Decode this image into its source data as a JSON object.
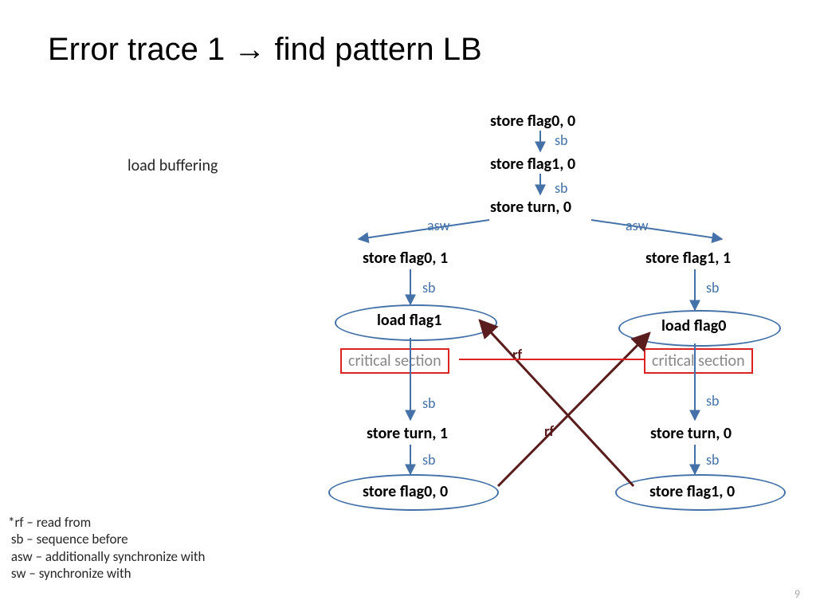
{
  "title": "Error trace 1 → find pattern LB",
  "subtitle": "load buffering",
  "nodes": {
    "n1": "store flag0, 0",
    "n2": "store flag1, 0",
    "n3": "store turn, 0",
    "n4": "store flag0, 1",
    "n5": "store flag1, 1",
    "n6": "load flag1",
    "n7": "load flag0",
    "crit1": "critical section",
    "crit2": "critical section",
    "n8": "store turn, 1",
    "n9": "store turn, 0",
    "n10": "store flag0, 0",
    "n11": "store flag1, 0"
  },
  "labels": {
    "sb": "sb",
    "asw": "asw",
    "rf": "rf"
  },
  "legend": {
    "l1": "*rf – read from",
    "l2": " sb – sequence before",
    "l3": " asw – additionally synchronize with",
    "l4": " sw – synchronize with"
  },
  "page": "9"
}
